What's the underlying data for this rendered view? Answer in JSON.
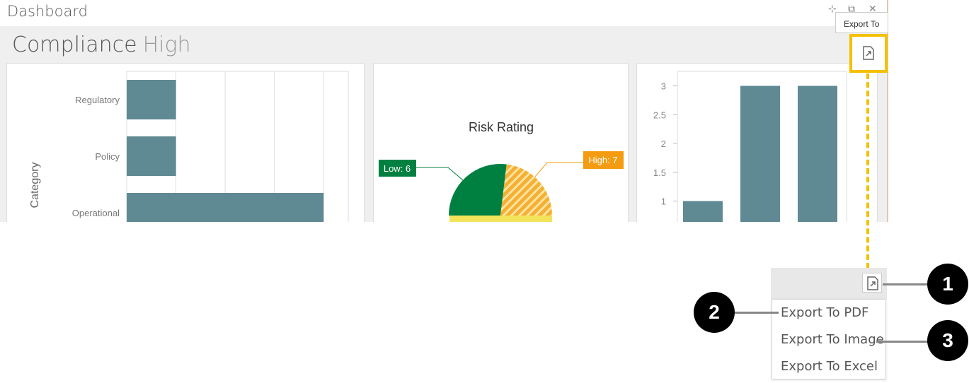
{
  "window": {
    "title": "Dashboard",
    "controls": {
      "pin": "⊹",
      "restore": "⧉",
      "close": "✕"
    }
  },
  "dashboard": {
    "title": "Compliance",
    "subtitle": "High"
  },
  "tooltip": {
    "text": "Export To"
  },
  "export_menu": {
    "items": [
      {
        "label": "Export To PDF"
      },
      {
        "label": "Export To Image"
      },
      {
        "label": "Export To Excel"
      }
    ]
  },
  "callouts": [
    "1",
    "2",
    "3"
  ],
  "colors": {
    "bar": "#5f8a93",
    "low": "#008040",
    "high": "#f39c12",
    "medium": "#f2e35a",
    "highlight": "#f5c000"
  },
  "chart_data": [
    {
      "type": "bar",
      "orientation": "horizontal",
      "categories": [
        "Regulatory",
        "Policy",
        "Operational"
      ],
      "values": [
        1,
        1,
        4
      ],
      "xlim": [
        0,
        4.5
      ],
      "ylabel": "Category"
    },
    {
      "type": "pie",
      "title": "Risk Rating",
      "slices": [
        {
          "name": "Low",
          "value": 6,
          "label": "Low: 6"
        },
        {
          "name": "High",
          "value": 7,
          "label": "High: 7"
        }
      ]
    },
    {
      "type": "bar",
      "values": [
        1,
        3,
        3
      ],
      "ylim": [
        0,
        3.2
      ],
      "yticks": [
        "3",
        "2.5",
        "2",
        "1.5",
        "1"
      ]
    }
  ]
}
